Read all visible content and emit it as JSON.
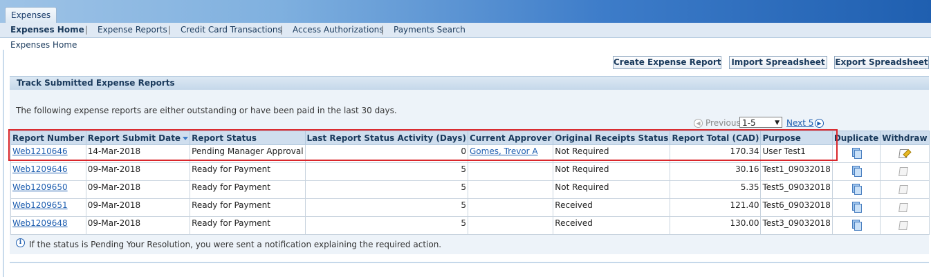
{
  "app": {
    "tab": "Expenses"
  },
  "subnav": {
    "items": [
      "Expenses Home",
      "Expense Reports",
      "Credit Card Transactions",
      "Access Authorizations",
      "Payments Search"
    ],
    "separator": "|"
  },
  "breadcrumb": "Expenses Home",
  "actions": {
    "create": "Create Expense Report",
    "import": "Import Spreadsheet",
    "export": "Export Spreadsheet"
  },
  "region": {
    "title": "Track Submitted Expense Reports",
    "intro": "The following expense reports are either outstanding or have been paid in the last 30 days."
  },
  "pagination": {
    "previous": "Previous",
    "range": "1-5",
    "next": "Next 5"
  },
  "table": {
    "headers": [
      "Report Number",
      "Report Submit Date",
      "Report Status",
      "Last Report Status Activity (Days)",
      "Current Approver",
      "Original Receipts Status",
      "Report Total (CAD)",
      "Purpose",
      "Duplicate",
      "Withdraw"
    ],
    "rows": [
      {
        "number": "Web1210646",
        "date": "14-Mar-2018",
        "status": "Pending Manager Approval",
        "days": "0",
        "approver": "Gomes, Trevor A",
        "receipts": "Not Required",
        "total": "170.34",
        "purpose": "User Test1",
        "withdraw_enabled": true
      },
      {
        "number": "Web1209646",
        "date": "09-Mar-2018",
        "status": "Ready for Payment",
        "days": "5",
        "approver": "",
        "receipts": "Not Required",
        "total": "30.16",
        "purpose": "Test1_09032018",
        "withdraw_enabled": false
      },
      {
        "number": "Web1209650",
        "date": "09-Mar-2018",
        "status": "Ready for Payment",
        "days": "5",
        "approver": "",
        "receipts": "Not Required",
        "total": "5.35",
        "purpose": "Test5_09032018",
        "withdraw_enabled": false
      },
      {
        "number": "Web1209651",
        "date": "09-Mar-2018",
        "status": "Ready for Payment",
        "days": "5",
        "approver": "",
        "receipts": "Received",
        "total": "121.40",
        "purpose": "Test6_09032018",
        "withdraw_enabled": false
      },
      {
        "number": "Web1209648",
        "date": "09-Mar-2018",
        "status": "Ready for Payment",
        "days": "5",
        "approver": "",
        "receipts": "Received",
        "total": "130.00",
        "purpose": "Test3_09032018",
        "withdraw_enabled": false
      }
    ]
  },
  "tip": "If the status is Pending Your Resolution, you were sent a notification explaining the required action.",
  "colors": {
    "highlight": "#d9262b",
    "link": "#1f5fb0",
    "header_bg": "#cfdeee"
  }
}
